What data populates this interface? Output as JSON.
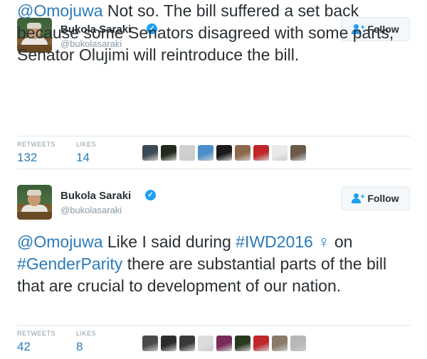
{
  "tweets": [
    {
      "author": "Bukola Saraki",
      "handle": "@bukolasaraki",
      "follow_label": "Follow",
      "text_parts": [
        {
          "type": "link",
          "text": "@Omojuwa"
        },
        {
          "type": "text",
          "text": " Not so. The bill suffered a set back because some Senators disagreed with some parts, Senator Olujimi will reintroduce the bill."
        }
      ],
      "retweets_label": "RETWEETS",
      "retweets": "132",
      "likes_label": "LIKES",
      "likes": "14",
      "liker_avatar_colors": [
        "#3c4a55",
        "#222a1e",
        "#cfcfcf",
        "#4a8fc9",
        "#1b1b1b",
        "#8c6a4a",
        "#c0262a",
        "#e9e9e9",
        "#6b5a4a"
      ]
    },
    {
      "author": "Bukola Saraki",
      "handle": "@bukolasaraki",
      "follow_label": "Follow",
      "text_parts": [
        {
          "type": "link",
          "text": "@Omojuwa"
        },
        {
          "type": "text",
          "text": " Like I said during "
        },
        {
          "type": "link",
          "text": "#IWD2016"
        },
        {
          "type": "emoji",
          "text": " ♀ "
        },
        {
          "type": "text",
          "text": " on "
        },
        {
          "type": "link",
          "text": "#GenderParity"
        },
        {
          "type": "text",
          "text": " there are substantial parts of the bill that are crucial to development of our nation."
        }
      ],
      "retweets_label": "RETWEETS",
      "retweets": "42",
      "likes_label": "LIKES",
      "likes": "8",
      "liker_avatar_colors": [
        "#4a4a4a",
        "#2c2c2c",
        "#3a3a3a",
        "#dcdcdc",
        "#7a2a5a",
        "#2a3a1e",
        "#c0262a",
        "#8a7a6a",
        "#b8b8b8"
      ]
    }
  ]
}
